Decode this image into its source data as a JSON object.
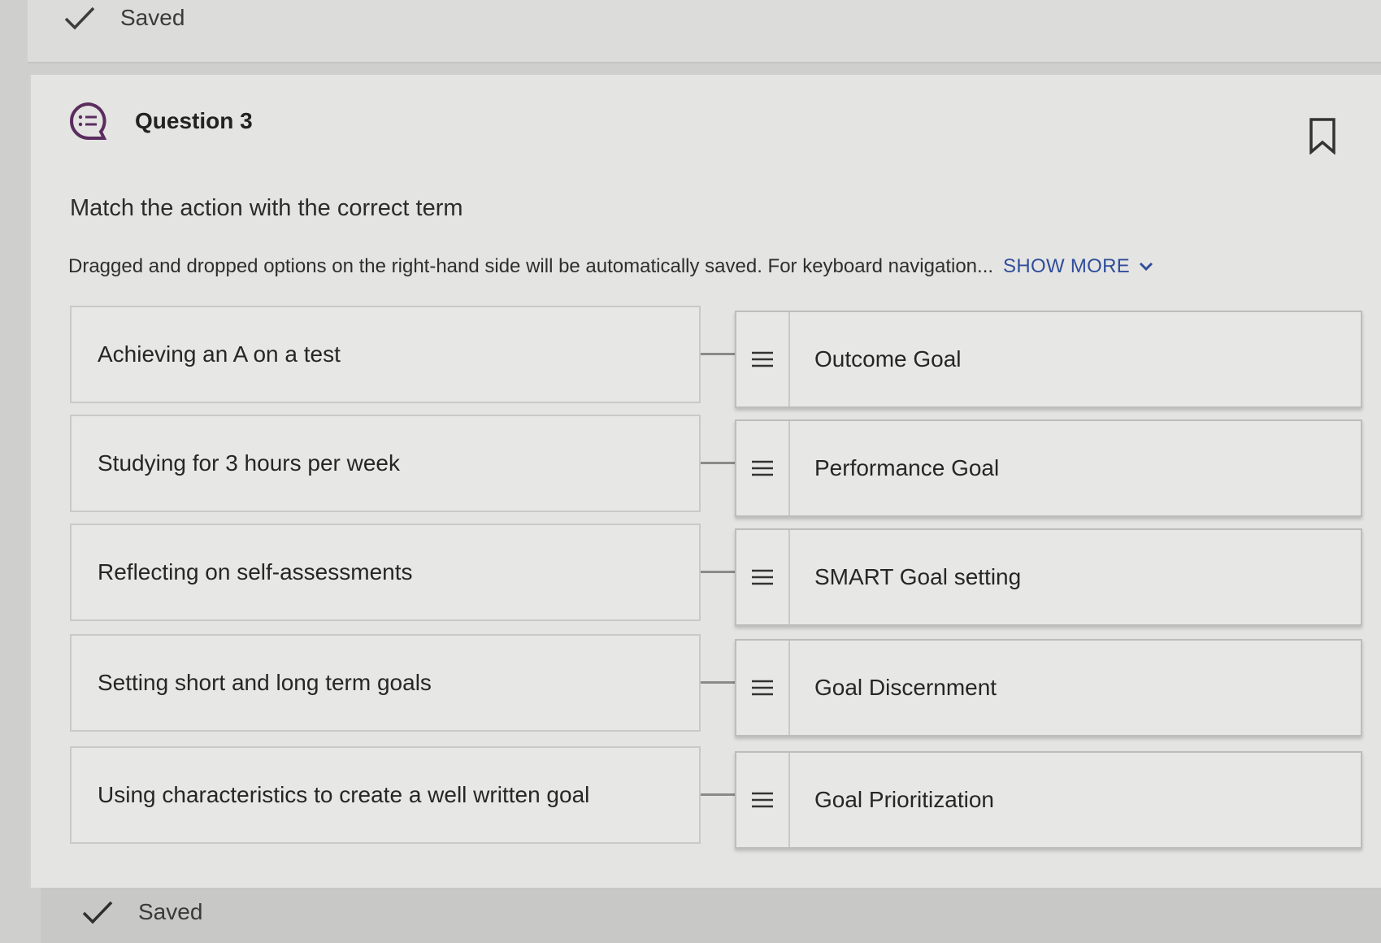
{
  "top_status": {
    "label": "Saved"
  },
  "question": {
    "title": "Question 3",
    "prompt": "Match the action with the correct term",
    "instructions": "Dragged and dropped options on the right-hand side will be automatically saved. For keyboard navigation...",
    "show_more_label": "SHOW MORE"
  },
  "pairs": [
    {
      "action": "Achieving an A on a test",
      "term": "Outcome Goal"
    },
    {
      "action": "Studying for 3 hours per week",
      "term": "Performance Goal"
    },
    {
      "action": "Reflecting on self-assessments",
      "term": "SMART Goal setting"
    },
    {
      "action": "Setting short and long term goals",
      "term": "Goal Discernment"
    },
    {
      "action": "Using characteristics to create a well written goal",
      "term": "Goal Prioritization"
    }
  ],
  "bottom_status": {
    "label": "Saved"
  },
  "icons": {
    "question": "question-list-icon",
    "bookmark": "bookmark-icon",
    "check": "check-icon",
    "handle": "drag-handle-icon",
    "chevron": "chevron-down-icon"
  },
  "colors": {
    "accent": "#2f4d9a",
    "question_icon": "#5a2d5e"
  }
}
